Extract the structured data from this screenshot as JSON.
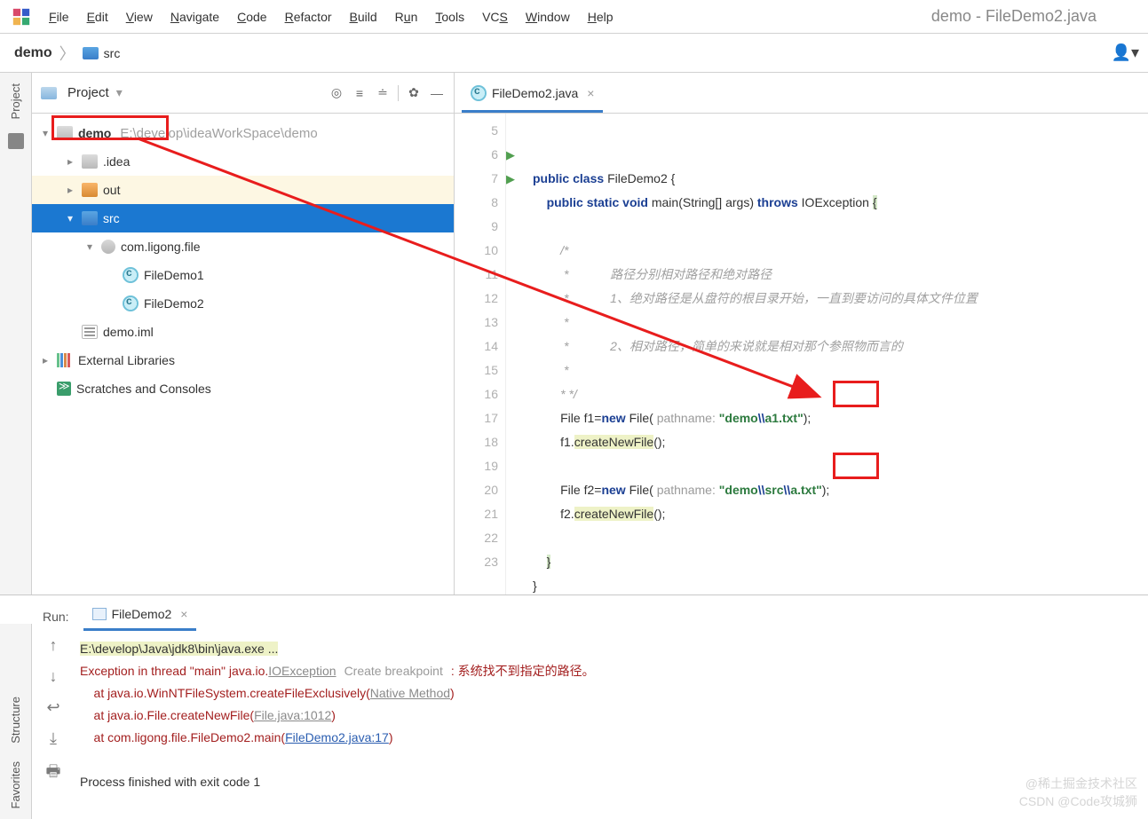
{
  "menu": {
    "items": [
      "File",
      "Edit",
      "View",
      "Navigate",
      "Code",
      "Refactor",
      "Build",
      "Run",
      "Tools",
      "VCS",
      "Window",
      "Help"
    ]
  },
  "window_title": "demo - FileDemo2.java",
  "breadcrumb": {
    "root": "demo",
    "child": "src"
  },
  "left_rail": {
    "label": "Project"
  },
  "bottom_rail": {
    "labels": [
      "Structure",
      "Favorites"
    ]
  },
  "project_panel": {
    "title": "Project",
    "tree": {
      "root": {
        "name": "demo",
        "path": "E:\\develop\\ideaWorkSpace\\demo"
      },
      "idea": ".idea",
      "out": "out",
      "src": "src",
      "pkg": "com.ligong.file",
      "file1": "FileDemo1",
      "file2": "FileDemo2",
      "iml": "demo.iml",
      "ext": "External Libraries",
      "scratch": "Scratches and Consoles"
    }
  },
  "editor": {
    "tab": "FileDemo2.java",
    "lines": [
      "5",
      "6",
      "7",
      "8",
      "9",
      "10",
      "11",
      "12",
      "13",
      "14",
      "15",
      "16",
      "17",
      "18",
      "19",
      "20",
      "21",
      "22",
      "23"
    ],
    "code": {
      "c_public": "public",
      "c_class": "class",
      "c_name": "FileDemo2",
      "c_static": "static",
      "c_void": "void",
      "c_main": "main",
      "c_args": "(String[] args)",
      "c_throws": "throws",
      "c_iox": "IOException",
      "cmt_open": "/*",
      "cmt_l1": "路径分别相对路径和绝对路径",
      "cmt_l2": "1、绝对路径是从盘符的根目录开始，一直到要访问的具体文件位置",
      "cmt_l3": "2、相对路径，简单的来说就是相对那个参照物而言的",
      "cmt_close": "* */",
      "f_file": "File",
      "f_new": "new",
      "c_hint": "pathname:",
      "f1_decl": "File f1=",
      "f1_str_a": "\"demo",
      "f1_str_b": "a1.txt\"",
      "f_esc": "\\\\",
      "f2_decl": "File f2=",
      "f2_str_a": "\"demo",
      "f2_str_b": "src",
      "f2_str_c": "a.txt\"",
      "call1": "f1.",
      "call2": "f2.",
      "createNew": "createNewFile",
      "parens": "();",
      "semi": ");"
    }
  },
  "run": {
    "label": "Run:",
    "tab": "FileDemo2",
    "console": {
      "exec": "E:\\develop\\Java\\jdk8\\bin\\java.exe ...",
      "exc_a": "Exception in thread \"main\" java.io.",
      "exc_link": "IOException",
      "exc_hint": "Create breakpoint",
      "exc_msg": "系统找不到指定的路径。",
      "at1_a": "    at java.io.WinNTFileSystem.createFileExclusively(",
      "at1_link": "Native Method",
      "at2_a": "    at java.io.File.createNewFile(",
      "at2_link": "File.java:1012",
      "at3_a": "    at com.ligong.file.FileDemo2.main(",
      "at3_link": "FileDemo2.java:17",
      "close": ")",
      "exit": "Process finished with exit code 1"
    }
  },
  "watermark": {
    "l1": "@稀土掘金技术社区",
    "l2": "CSDN @Code攻城狮"
  }
}
